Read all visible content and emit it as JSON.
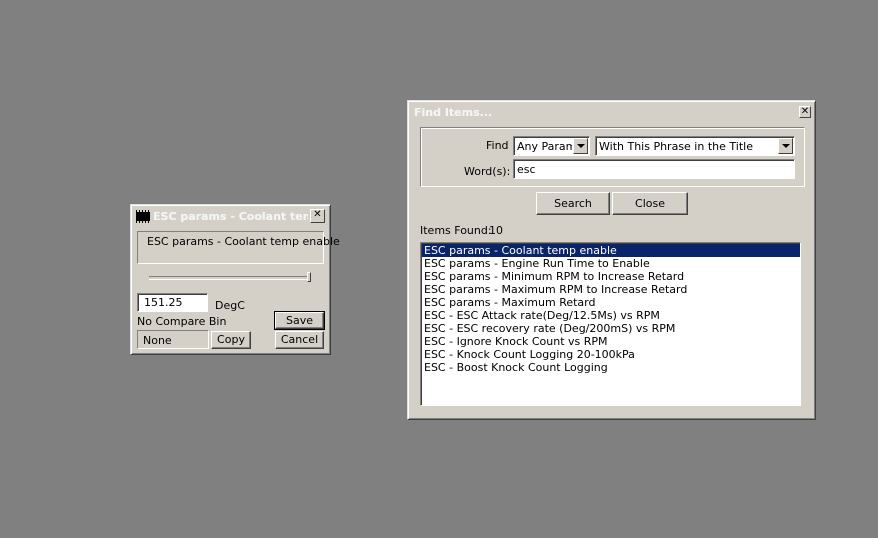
{
  "esc_window": {
    "title": "ESC params - Coolant tem...",
    "param_name": "ESC params - Coolant temp enable",
    "value": "151.25",
    "unit": "DegC",
    "compare_label": "No Compare Bin",
    "compare_value": "None",
    "copy_label": "Copy",
    "save_label": "Save",
    "cancel_label": "Cancel",
    "close_glyph": "✕",
    "slider_fraction": 1.0
  },
  "find_window": {
    "title": "Find Items...",
    "close_glyph": "✕",
    "find_label": "Find",
    "find_type_value": "Any Parame",
    "match_mode_value": "With This Phrase in the Title",
    "words_label": "Word(s):",
    "words_value": "esc",
    "search_label": "Search",
    "close_label": "Close",
    "items_found_label": "Items Found:",
    "items_found_count": "10",
    "items": [
      "ESC params - Coolant temp enable",
      "ESC params - Engine Run Time to Enable",
      "ESC params - Minimum RPM to Increase Retard",
      "ESC params - Maximum RPM to Increase Retard",
      "ESC params - Maximum Retard",
      "ESC - ESC Attack rate(Deg/12.5Ms) vs RPM",
      "ESC - ESC recovery rate (Deg/200mS) vs RPM",
      "ESC - Ignore Knock Count vs RPM",
      "ESC - Knock Count Logging 20-100kPa",
      "ESC - Boost Knock Count Logging"
    ],
    "selected_index": 0
  },
  "icons": {
    "esc_window_icon": "chip-icon"
  }
}
